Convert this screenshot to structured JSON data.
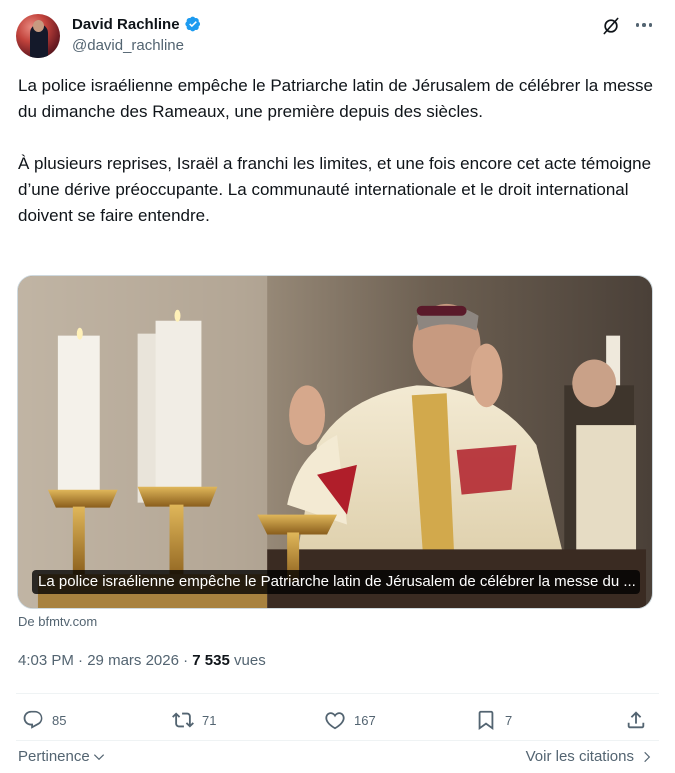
{
  "author": {
    "display_name": "David Rachline",
    "handle": "@david_rachline",
    "verified_icon": "verified-badge-icon"
  },
  "tweet": {
    "paragraphs": [
      "La police israélienne empêche le Patriarche latin de Jérusalem de célébrer la messe du dimanche des Rameaux, une première depuis des siècles.",
      "À plusieurs reprises, Israël a franchi les limites, et une fois encore cet acte témoigne d’une dérive préoccupante. La communauté internationale et le droit international doivent se faire entendre."
    ]
  },
  "media": {
    "caption": "La police israélienne empêche le Patriarche latin de Jérusalem de célébrer la messe du ...",
    "source": "De bfmtv.com"
  },
  "meta": {
    "time": "4:03 PM",
    "separator": " · ",
    "date": "29 mars 2026",
    "views_count": "7 535",
    "views_label": " vues"
  },
  "actions": {
    "replies": "85",
    "reposts": "71",
    "likes": "167",
    "bookmarks": "7"
  },
  "footer": {
    "sort_label": "Pertinence",
    "quotes_link": "Voir les citations"
  },
  "colors": {
    "text": "#0f1419",
    "secondary": "#536471",
    "verified_blue": "#1d9bf0",
    "divider": "#eff3f4"
  }
}
